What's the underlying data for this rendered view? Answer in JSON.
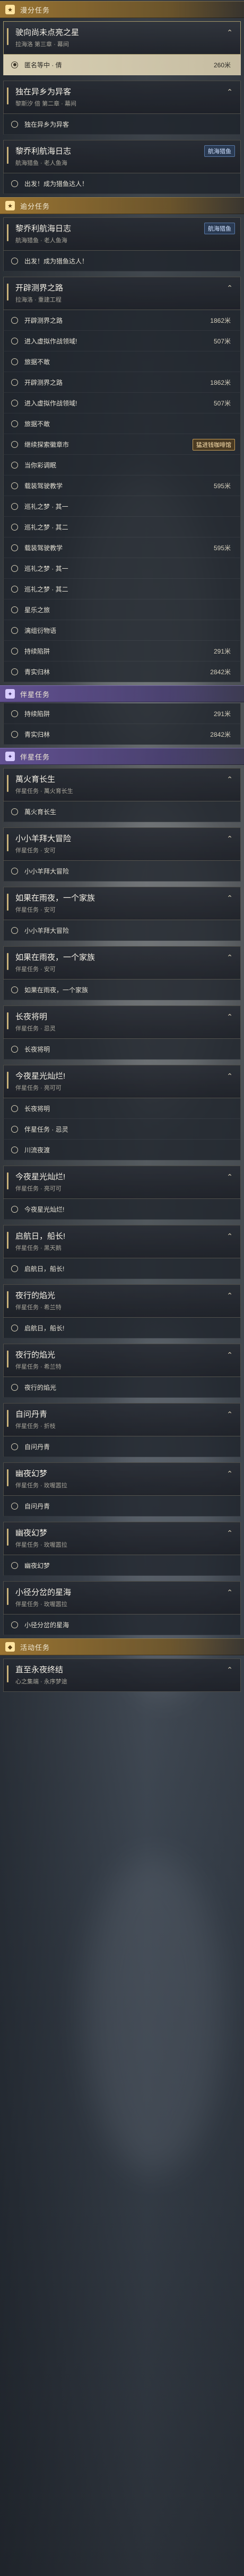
{
  "sections": [
    {
      "header": {
        "icon": "★",
        "title": "漫分任务",
        "style": "gold"
      },
      "quests": [
        {
          "title": "驶向尚未点亮之星",
          "sub": "拉海洛 第三章 · 幕间",
          "highlight": true,
          "collapse": "⌃",
          "tasks": [
            {
              "text": "匿名等中 · 倩",
              "dist": "260米",
              "selected": true,
              "radio": "filled"
            }
          ]
        },
        {
          "title": "独在异乡为异客",
          "sub": "黎斯汐 倍 第二章 · 幕间",
          "collapse": "⌃",
          "tasks": [
            {
              "text": "独在异乡为异客",
              "dist": ""
            }
          ]
        },
        {
          "title": "黎乔利航海日志",
          "sub": "航海猎鱼 · 老人鱼海",
          "tag": "航海猎鱼",
          "collapse": "⌃",
          "tasks": [
            {
              "text": "出发！成为猎鱼达人！",
              "dist": ""
            }
          ]
        }
      ]
    },
    {
      "header": {
        "icon": "★",
        "title": "逾分任务",
        "style": "gold"
      },
      "quests": [
        {
          "title": "黎乔利航海日志",
          "sub": "航海猎鱼 · 老人鱼海",
          "tag": "航海猎鱼",
          "collapse": "⌃",
          "tasks": [
            {
              "text": "出发！成为猎鱼达人！",
              "dist": ""
            }
          ]
        },
        {
          "title": "开辟测界之路",
          "sub": "拉海洛 · 重建工程",
          "collapse": "⌃",
          "tasks": [
            {
              "text": "开辟测界之路",
              "dist": "1862米"
            },
            {
              "text": "进入虚拟作战领域!",
              "dist": "507米"
            },
            {
              "text": "旅据不敢",
              "dist": ""
            },
            {
              "text": "开辟测界之路",
              "dist": "1862米"
            },
            {
              "text": "进入虚拟作战领域!",
              "dist": "507米"
            },
            {
              "text": "旅据不敢",
              "dist": ""
            },
            {
              "text": "继续探索徽章市",
              "dist": "",
              "tag": "猛进钱咖啡馆"
            },
            {
              "text": "当你彩调眠",
              "dist": ""
            },
            {
              "text": "载装驾驶教学",
              "dist": "595米"
            },
            {
              "text": "巡礼之梦 · 其一",
              "dist": ""
            },
            {
              "text": "巡礼之梦 · 其二",
              "dist": ""
            },
            {
              "text": "载装驾驶教学",
              "dist": "595米"
            },
            {
              "text": "巡礼之梦 · 其一",
              "dist": ""
            },
            {
              "text": "巡礼之梦 · 其二",
              "dist": ""
            },
            {
              "text": "星乐之旅",
              "dist": ""
            },
            {
              "text": "漓组衍物语",
              "dist": ""
            },
            {
              "text": "持续陷阱",
              "dist": "291米"
            },
            {
              "text": "青实归林",
              "dist": "2842米"
            }
          ]
        }
      ]
    },
    {
      "header": {
        "icon": "✦",
        "title": "伴星任务",
        "style": "purple"
      },
      "quests": [
        {
          "title": "",
          "sub": "",
          "bare": true,
          "tasks": [
            {
              "text": "持续陷阱",
              "dist": "291米"
            },
            {
              "text": "青实归林",
              "dist": "2842米"
            }
          ]
        }
      ]
    },
    {
      "header": {
        "icon": "✦",
        "title": "伴星任务",
        "style": "purple"
      },
      "quests": [
        {
          "title": "萬火育长生",
          "sub": "伴星任务 · 萬火育长生",
          "collapse": "⌃",
          "tasks": [
            {
              "text": "萬火育长生",
              "dist": ""
            }
          ]
        },
        {
          "title": "小小羊拜大冒险",
          "sub": "伴星任务 · 安可",
          "collapse": "⌃",
          "tasks": [
            {
              "text": "小小羊拜大冒险",
              "dist": ""
            }
          ]
        },
        {
          "title": "如果在雨夜，一个家族",
          "sub": "伴星任务 · 安可",
          "collapse": "⌃",
          "tasks": [
            {
              "text": "小小羊拜大冒险",
              "dist": ""
            }
          ]
        },
        {
          "title": "如果在雨夜，一个家族",
          "sub": "伴星任务 · 安可",
          "collapse": "⌃",
          "tasks": [
            {
              "text": "如果在雨夜，一个家族",
              "dist": ""
            }
          ]
        },
        {
          "title": "长夜将明",
          "sub": "伴星任务 · 忌灵",
          "collapse": "⌃",
          "tasks": [
            {
              "text": "长夜将明",
              "dist": ""
            }
          ]
        },
        {
          "title": "今夜星光灿烂!",
          "sub": "伴星任务 · 亮可可",
          "collapse": "⌃",
          "tasks": [
            {
              "text": "长夜将明",
              "dist": ""
            },
            {
              "text": "伴星任务 · 忌灵",
              "dist": ""
            },
            {
              "text": "川流夜渡",
              "dist": ""
            }
          ]
        },
        {
          "title": "今夜星光灿烂!",
          "sub": "伴星任务 · 亮可可",
          "collapse": "⌃",
          "tasks": [
            {
              "text": "今夜星光灿烂!",
              "dist": ""
            }
          ]
        },
        {
          "title": "启航日，船长!",
          "sub": "伴星任务 · 黑天鹅",
          "collapse": "⌃",
          "tasks": [
            {
              "text": "启航日，船长!",
              "dist": ""
            }
          ]
        },
        {
          "title": "夜行的焰光",
          "sub": "伴星任务 · 希兰特",
          "collapse": "⌃",
          "tasks": [
            {
              "text": "启航日，船长!",
              "dist": ""
            }
          ]
        },
        {
          "title": "夜行的焰光",
          "sub": "伴星任务 · 希兰特",
          "collapse": "⌃",
          "tasks": [
            {
              "text": "夜行的焰光",
              "dist": ""
            }
          ]
        },
        {
          "title": "自问丹青",
          "sub": "伴星任务 · 折枝",
          "collapse": "⌃",
          "tasks": [
            {
              "text": "自问丹青",
              "dist": ""
            }
          ]
        },
        {
          "title": "幽夜幻梦",
          "sub": "伴星任务 · 玫喔嚣拉",
          "collapse": "⌃",
          "tasks": [
            {
              "text": "自问丹青",
              "dist": ""
            }
          ]
        },
        {
          "title": "幽夜幻梦",
          "sub": "伴星任务 · 玫喔嚣拉",
          "collapse": "⌃",
          "tasks": [
            {
              "text": "幽夜幻梦",
              "dist": ""
            }
          ]
        },
        {
          "title": "小径分岔的星海",
          "sub": "伴星任务 · 玫喔嚣拉",
          "collapse": "⌃",
          "tasks": [
            {
              "text": "小径分岔的星海",
              "dist": ""
            }
          ]
        }
      ]
    },
    {
      "header": {
        "icon": "◆",
        "title": "活动任务",
        "style": "gold"
      },
      "quests": [
        {
          "title": "直至永夜终结",
          "sub": "心之集端 · 永序梦途",
          "collapse": "⌃",
          "tasks": []
        }
      ]
    }
  ]
}
